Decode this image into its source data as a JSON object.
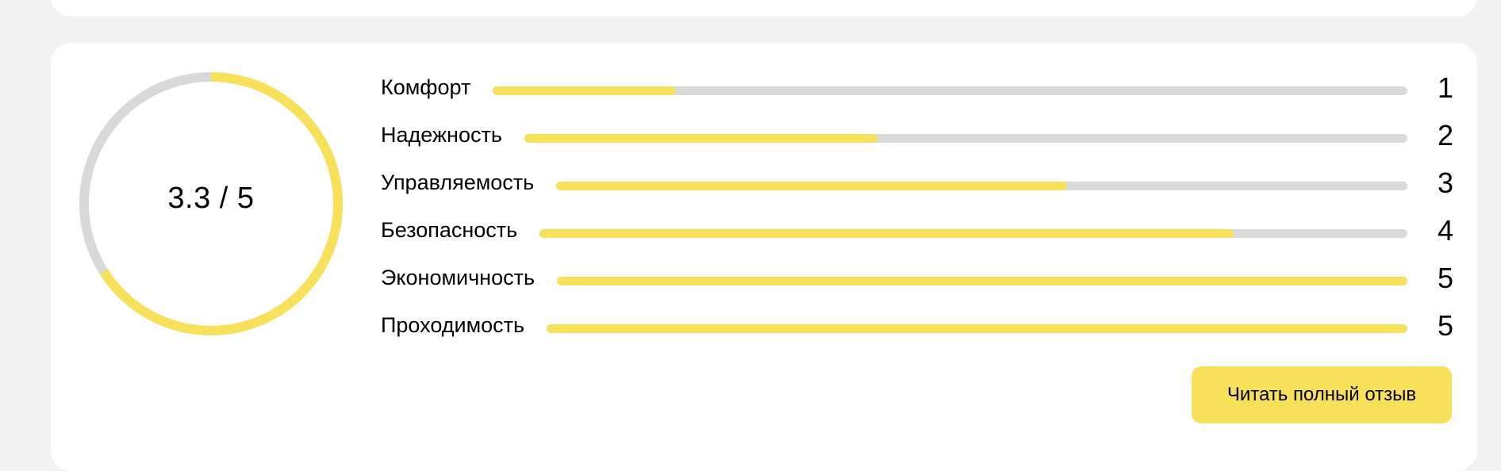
{
  "score": {
    "value": 3.3,
    "max": 5,
    "label": "3.3 / 5"
  },
  "ratings": [
    {
      "label": "Комфорт",
      "value": 1,
      "max": 5
    },
    {
      "label": "Надежность",
      "value": 2,
      "max": 5
    },
    {
      "label": "Управляемость",
      "value": 3,
      "max": 5
    },
    {
      "label": "Безопасность",
      "value": 4,
      "max": 5
    },
    {
      "label": "Экономичность",
      "value": 5,
      "max": 5
    },
    {
      "label": "Проходимость",
      "value": 5,
      "max": 5
    }
  ],
  "actions": {
    "read_full_review": "Читать полный отзыв"
  },
  "colors": {
    "accent": "#f8e15a",
    "track": "#d9d9d9",
    "card": "#ffffff",
    "background": "#f2f2f2"
  }
}
